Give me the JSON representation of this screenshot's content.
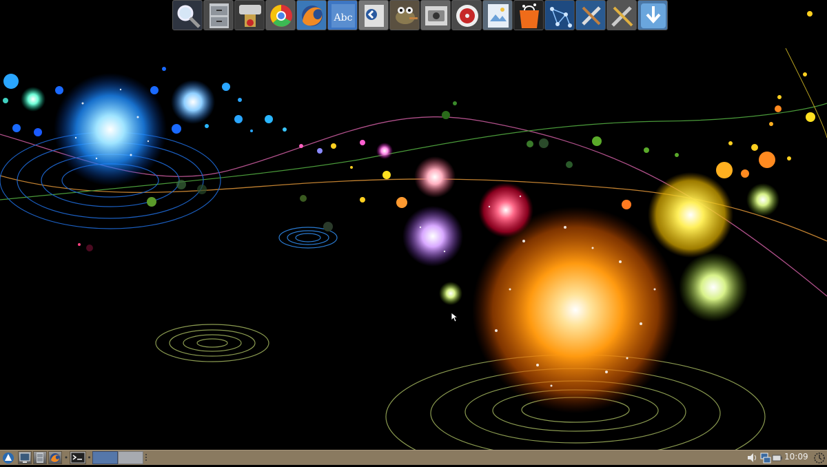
{
  "dock": {
    "items": [
      {
        "name": "search-icon",
        "color": "#dfe9f3"
      },
      {
        "name": "file-cabinet-icon",
        "color": "#8f959c"
      },
      {
        "name": "cd-burner-icon",
        "color": "#c9a24a"
      },
      {
        "name": "chrome-icon",
        "color": "#4a86e8"
      },
      {
        "name": "firefox-icon",
        "color": "#f08a24"
      },
      {
        "name": "abiword-icon",
        "color": "#3d76c4"
      },
      {
        "name": "installer-icon",
        "color": "#bdbdbd"
      },
      {
        "name": "gimp-icon",
        "color": "#8a7a50"
      },
      {
        "name": "screenshot-icon",
        "color": "#d6d6d6"
      },
      {
        "name": "music-player-icon",
        "color": "#c62828"
      },
      {
        "name": "image-viewer-icon",
        "color": "#e6eef7"
      },
      {
        "name": "package-manager-icon",
        "color": "#ef6c1a"
      },
      {
        "name": "network-icon",
        "color": "#4c8fd6"
      },
      {
        "name": "system-tools-icon",
        "color": "#c0c0c0"
      },
      {
        "name": "settings-tools-icon",
        "color": "#9a9a9a"
      },
      {
        "name": "download-icon",
        "color": "#6aa6dd"
      }
    ]
  },
  "taskbar": {
    "background": "#8a7a60",
    "launchers": [
      {
        "name": "start-menu-icon"
      },
      {
        "name": "show-desktop-icon"
      },
      {
        "name": "file-manager-icon"
      },
      {
        "name": "browser-icon"
      },
      {
        "name": "terminal-icon"
      }
    ],
    "pager": {
      "active_color": "#5577aa",
      "inactive_color": "#a7aab0"
    },
    "tray": [
      {
        "name": "volume-icon"
      },
      {
        "name": "network-status-icon"
      },
      {
        "name": "battery-icon"
      }
    ],
    "clock": "10:09"
  }
}
